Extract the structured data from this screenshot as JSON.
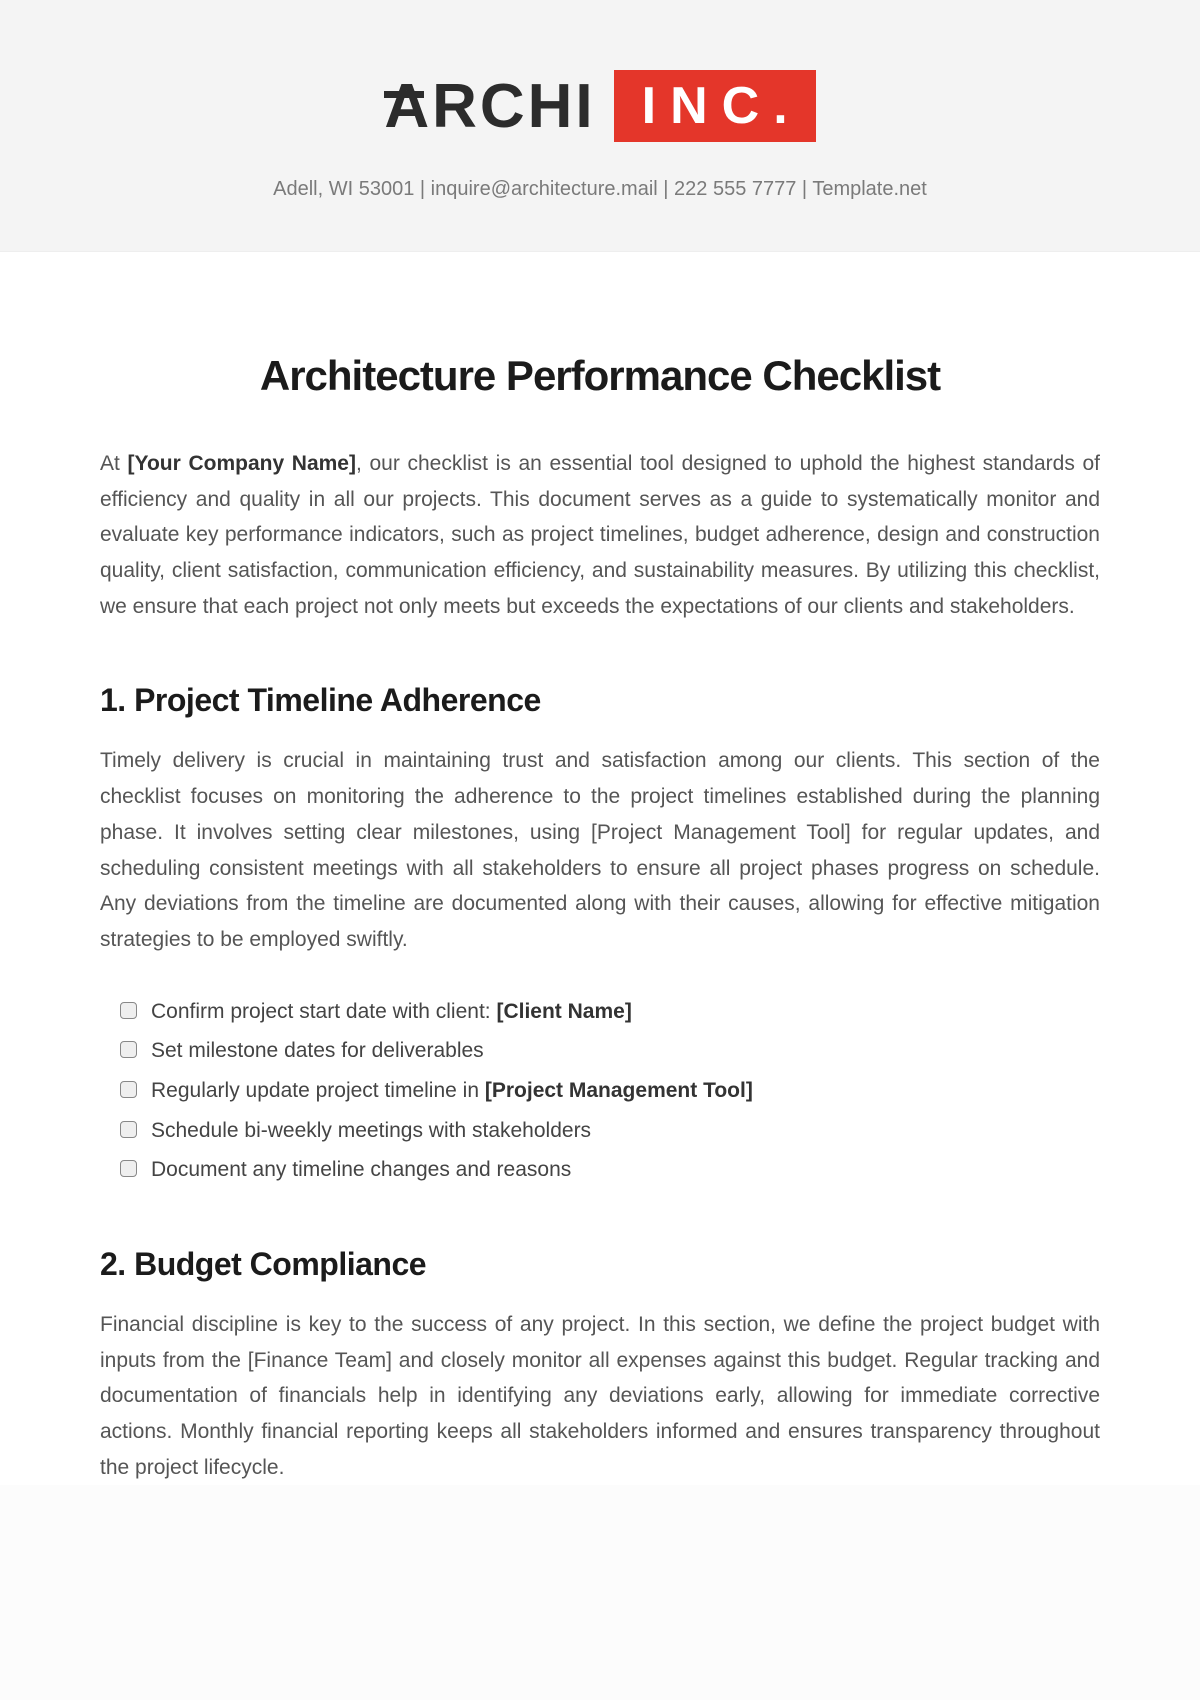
{
  "logo": {
    "left": "ARCHI",
    "right": "INC."
  },
  "contact": "Adell, WI 53001 | inquire@architecture.mail | 222 555 7777 | Template.net",
  "title": "Architecture Performance Checklist",
  "intro_prefix": "At ",
  "intro_company": "[Your Company Name]",
  "intro_rest": ", our checklist is an essential tool designed to uphold the highest standards of efficiency and quality in all our projects. This document serves as a guide to systematically monitor and evaluate key performance indicators, such as project timelines, budget adherence, design and construction quality, client satisfaction, communication efficiency, and sustainability measures. By utilizing this checklist, we ensure that each project not only meets but exceeds the expectations of our clients and stakeholders.",
  "section1": {
    "heading": "1. Project Timeline Adherence",
    "body": "Timely delivery is crucial in maintaining trust and satisfaction among our clients. This section of the checklist focuses on monitoring the adherence to the project timelines established during the planning phase. It involves setting clear milestones, using [Project Management Tool] for regular updates, and scheduling consistent meetings with all stakeholders to ensure all project phases progress on schedule. Any deviations from the timeline are documented along with their causes, allowing for effective mitigation strategies to be employed swiftly.",
    "items": [
      {
        "pre": "Confirm project start date with client: ",
        "bold": "[Client Name]",
        "post": ""
      },
      {
        "pre": "Set milestone dates for deliverables",
        "bold": "",
        "post": ""
      },
      {
        "pre": "Regularly update project timeline in ",
        "bold": "[Project Management Tool]",
        "post": ""
      },
      {
        "pre": "Schedule bi-weekly meetings with stakeholders",
        "bold": "",
        "post": ""
      },
      {
        "pre": "Document any timeline changes and reasons",
        "bold": "",
        "post": ""
      }
    ]
  },
  "section2": {
    "heading": "2. Budget Compliance",
    "body": "Financial discipline is key to the success of any project. In this section, we define the project budget with inputs from the [Finance Team] and closely monitor all expenses against this budget. Regular tracking and documentation of financials help in identifying any deviations early, allowing for immediate corrective actions. Monthly financial reporting keeps all stakeholders informed and ensures transparency throughout the project lifecycle."
  }
}
